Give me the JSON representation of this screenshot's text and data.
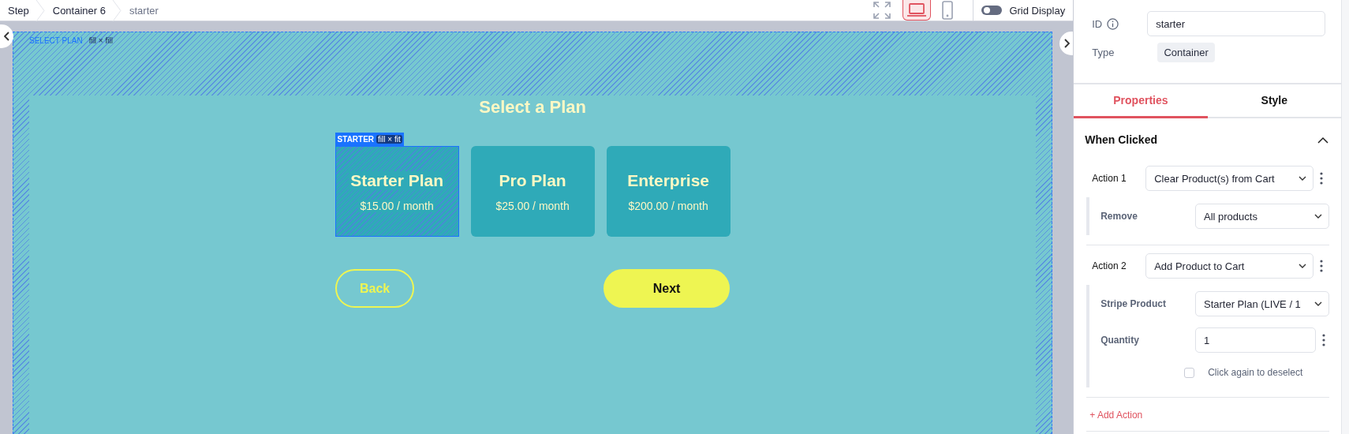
{
  "breadcrumb": [
    {
      "label": "Step",
      "current": false
    },
    {
      "label": "Container 6",
      "current": false
    },
    {
      "label": "starter",
      "current": true
    }
  ],
  "toolbar": {
    "devices": [
      {
        "kind": "fit",
        "selected": false
      },
      {
        "kind": "desktop",
        "selected": true
      },
      {
        "kind": "mobile",
        "selected": false
      }
    ],
    "grid_display": {
      "label": "Grid Display",
      "on": false
    }
  },
  "canvas": {
    "selection": {
      "name": "SELECT PLAN",
      "size": "fill × fill"
    },
    "title": "Select a Plan",
    "plans": [
      {
        "name": "Starter Plan",
        "price": "$15.00 / month",
        "selected": true,
        "tag": "STARTER",
        "size": "fill × fit"
      },
      {
        "name": "Pro Plan",
        "price": "$25.00 / month",
        "selected": false
      },
      {
        "name": "Enterprise",
        "price": "$200.00 / month",
        "selected": false
      }
    ],
    "buttons": [
      {
        "kind": "outline",
        "label": "Back"
      },
      {
        "kind": "filled",
        "label": "Next"
      }
    ]
  },
  "panel": {
    "id": {
      "label": "ID",
      "value": "starter"
    },
    "type": {
      "label": "Type",
      "value": "Container"
    },
    "tabs": [
      {
        "label": "Properties",
        "selected": true
      },
      {
        "label": "Style",
        "selected": false
      }
    ],
    "section": {
      "title": "When Clicked",
      "expanded": true
    },
    "actions": [
      {
        "label": "Action 1",
        "value": "Clear Product(s) from Cart",
        "params": [
          {
            "kind": "select",
            "label": "Remove",
            "value": "All products"
          }
        ]
      },
      {
        "label": "Action 2",
        "value": "Add Product to Cart",
        "params": [
          {
            "kind": "select",
            "label": "Stripe Product",
            "value": "Starter Plan (LIVE / 1"
          },
          {
            "kind": "input",
            "label": "Quantity",
            "value": "1"
          },
          {
            "kind": "checkbox",
            "label": "Click again to deselect",
            "checked": false
          }
        ]
      }
    ],
    "add_action": "+ Add Action"
  }
}
